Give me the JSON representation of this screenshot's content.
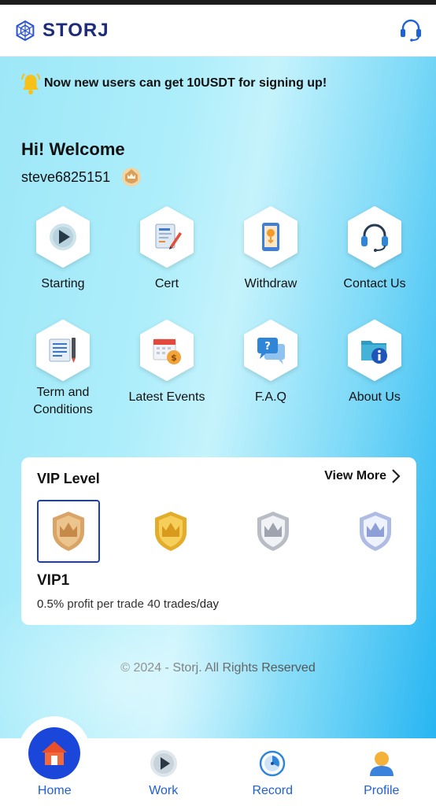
{
  "brand": {
    "name": "STORJ"
  },
  "notice": {
    "text": "Now new users can get 10USDT for signing up!"
  },
  "welcome": {
    "greeting": "Hi! Welcome",
    "username": "steve6825151"
  },
  "menu": [
    {
      "label": "Starting",
      "icon": "play-icon"
    },
    {
      "label": "Cert",
      "icon": "certificate-icon"
    },
    {
      "label": "Withdraw",
      "icon": "withdraw-phone-icon"
    },
    {
      "label": "Contact Us",
      "icon": "headset-icon"
    },
    {
      "label": "Term and Conditions",
      "icon": "document-pen-icon"
    },
    {
      "label": "Latest Events",
      "icon": "calendar-coin-icon"
    },
    {
      "label": "F.A.Q",
      "icon": "chat-question-icon"
    },
    {
      "label": "About Us",
      "icon": "folder-info-icon"
    }
  ],
  "vip": {
    "title": "VIP Level",
    "view_more": "View More",
    "selected_name": "VIP1",
    "selected_desc": "0.5% profit per trade 40 trades/day",
    "badges": [
      "bronze-crown-badge-icon",
      "gold-crown-badge-icon",
      "silver-crown-badge-icon",
      "platinum-crown-badge-icon"
    ]
  },
  "footer": {
    "copyright": "© 2024 - Storj. All Rights Reserved"
  },
  "nav": [
    {
      "label": "Home",
      "icon": "home-icon",
      "active": true
    },
    {
      "label": "Work",
      "icon": "play-circle-icon"
    },
    {
      "label": "Record",
      "icon": "record-timer-icon"
    },
    {
      "label": "Profile",
      "icon": "profile-icon"
    }
  ],
  "colors": {
    "brand": "#1c2c7a",
    "accent": "#1a47d9",
    "nav_text": "#1e5fd9"
  }
}
